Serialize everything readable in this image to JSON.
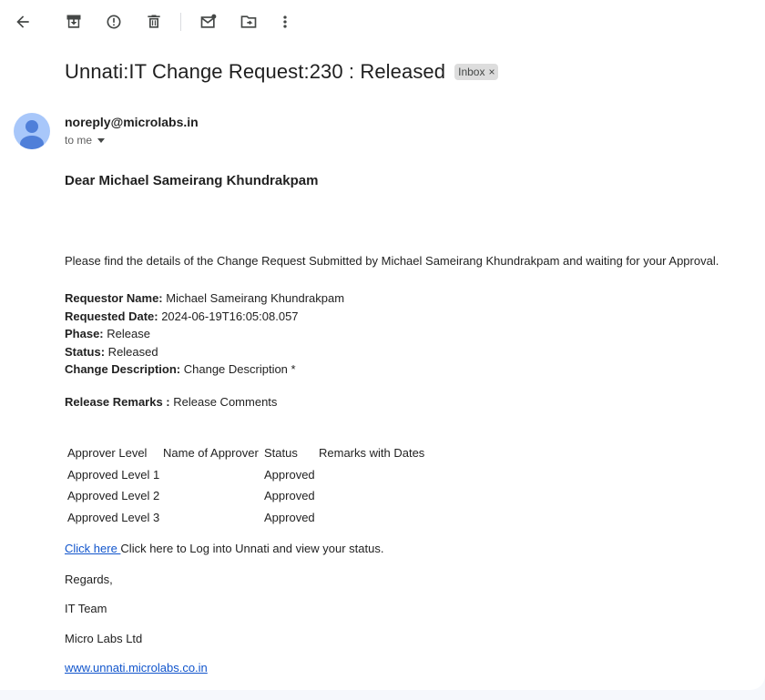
{
  "toolbar": {
    "icons": [
      "back-arrow-icon",
      "archive-icon",
      "report-spam-icon",
      "delete-icon",
      "mark-unread-icon",
      "move-to-icon",
      "more-vert-icon"
    ]
  },
  "email": {
    "subject": "Unnati:IT Change Request:230 : Released",
    "label": "Inbox",
    "label_close": "×",
    "sender": "noreply@microlabs.in",
    "recipient": "to me",
    "colors": {
      "link": "#1155cc",
      "avatar": "#a8c7fa",
      "avatar_figure": "#4f7fd9"
    }
  },
  "body": {
    "greeting": "Dear Michael Sameirang Khundrakpam",
    "intro": "Please find the details of the Change Request Submitted by Michael Sameirang Khundrakpam and waiting for your Approval.",
    "requestor_label": "Requestor Name:",
    "requestor_value": " Michael Sameirang Khundrakpam",
    "date_label": "Requested Date:",
    "date_value": " 2024-06-19T16:05:08.057",
    "phase_label": "Phase:",
    "phase_value": " Release",
    "status_label": "Status:",
    "status_value": " Released",
    "desc_label": "Change Description:",
    "desc_value": " Change Description *",
    "remarks_label": "Release Remarks :",
    "remarks_value": " Release Comments",
    "table": {
      "headers": [
        "Approver Level",
        "Name of Approver",
        "Status",
        "Remarks with Dates"
      ],
      "rows": [
        [
          "Approved Level 1",
          "",
          "Approved",
          ""
        ],
        [
          "Approved Level 2",
          "",
          "Approved",
          ""
        ],
        [
          "Approved Level 3",
          "",
          "Approved",
          ""
        ]
      ]
    },
    "login_link": "Click here ",
    "login_text": "Click here to Log into Unnati and view your status.",
    "regards": "Regards,",
    "team": "IT Team",
    "company": "Micro Labs Ltd",
    "website": "www.unnati.microlabs.co.in"
  }
}
